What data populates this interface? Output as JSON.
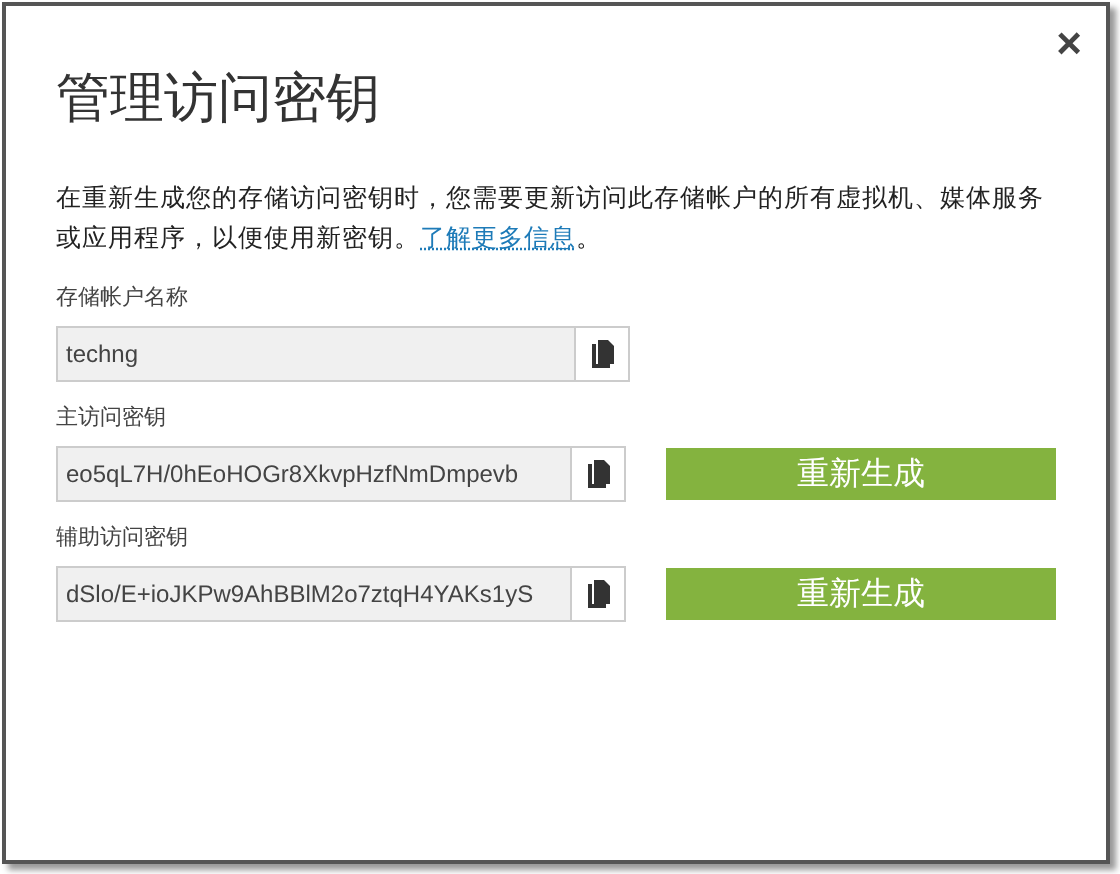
{
  "dialog": {
    "title": "管理访问密钥",
    "close": "×",
    "description": "在重新生成您的存储访问密钥时，您需要更新访问此存储帐户的所有虚拟机、媒体服务或应用程序，以便使用新密钥。",
    "link": "了解更多信息",
    "link_suffix": "。",
    "fields": [
      {
        "label": "存储帐户名称",
        "value": "techng"
      },
      {
        "label": "主访问密钥",
        "value": "eo5qL7H/0hEoHOGr8XkvpHzfNmDmpevb",
        "button": "重新生成"
      },
      {
        "label": "辅助访问密钥",
        "value": "dSlo/E+ioJKPw9AhBBlM2o7ztqH4YAKs1yS",
        "button": "重新生成"
      }
    ]
  }
}
